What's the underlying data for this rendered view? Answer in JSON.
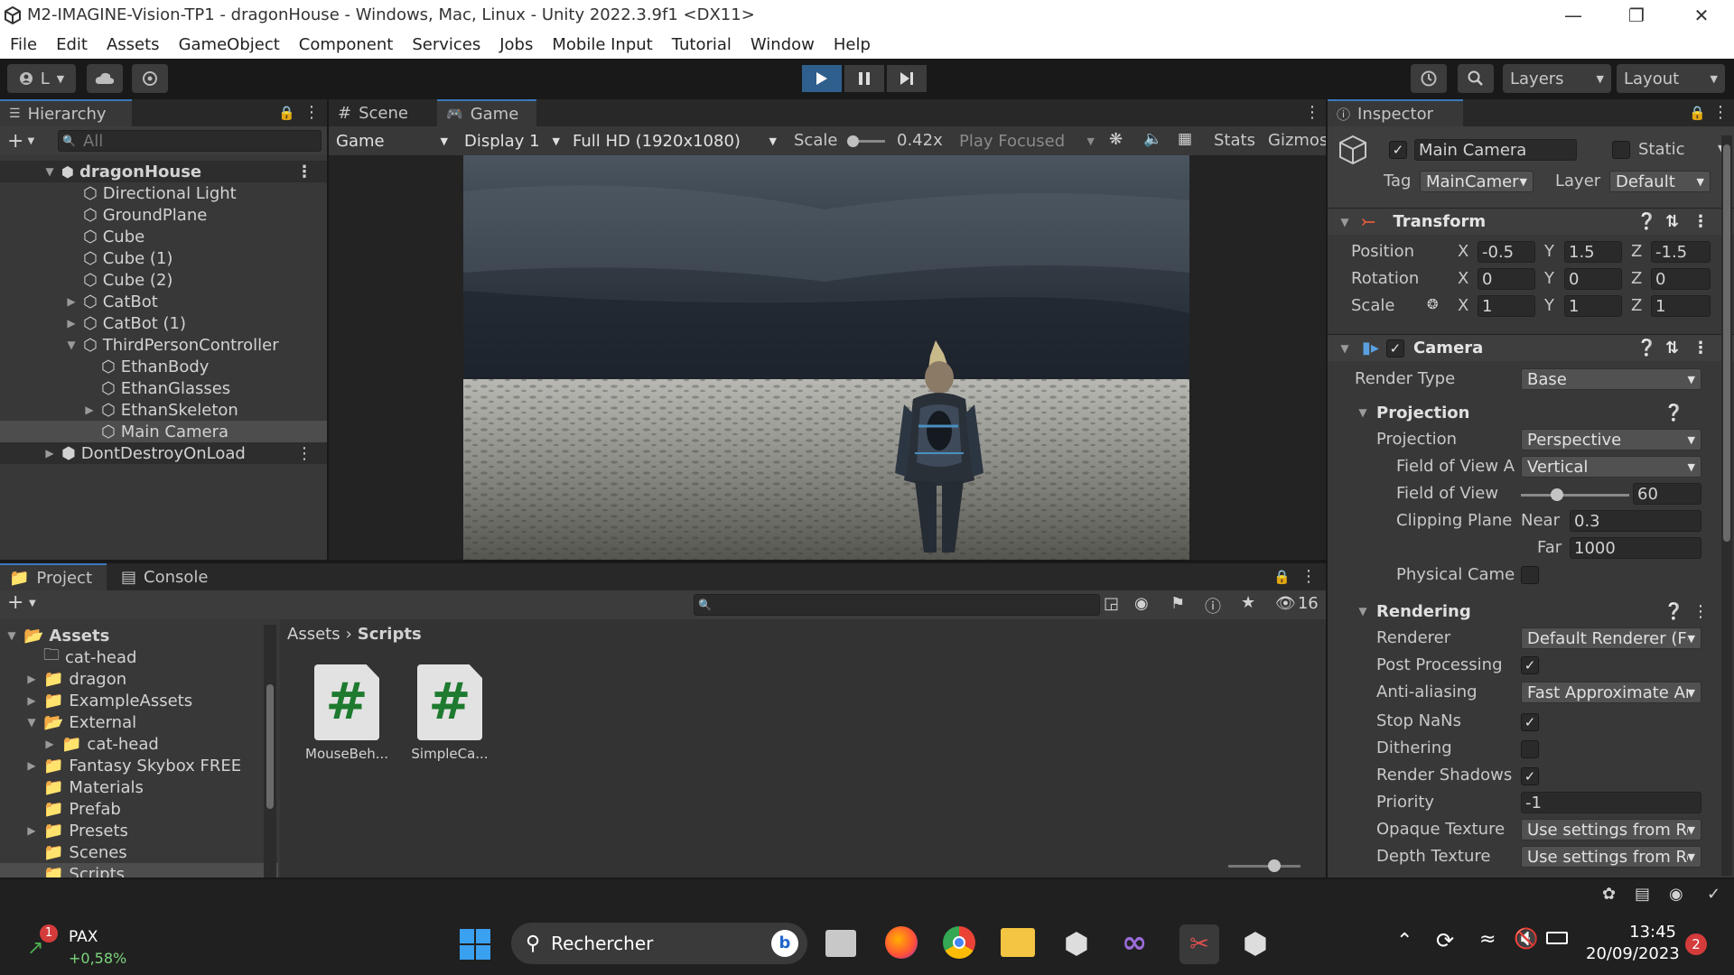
{
  "window": {
    "title": "M2-IMAGINE-Vision-TP1 - dragonHouse - Windows, Mac, Linux - Unity 2022.3.9f1 <DX11>"
  },
  "menu": [
    "File",
    "Edit",
    "Assets",
    "GameObject",
    "Component",
    "Services",
    "Jobs",
    "Mobile Input",
    "Tutorial",
    "Window",
    "Help"
  ],
  "toolbar": {
    "account_label": "L",
    "layers_label": "Layers",
    "layout_label": "Layout"
  },
  "hierarchy": {
    "tab": "Hierarchy",
    "search_placeholder": "All",
    "items": [
      {
        "label": "dragonHouse"
      },
      {
        "label": "Directional Light"
      },
      {
        "label": "GroundPlane"
      },
      {
        "label": "Cube"
      },
      {
        "label": "Cube (1)"
      },
      {
        "label": "Cube (2)"
      },
      {
        "label": "CatBot"
      },
      {
        "label": "CatBot (1)"
      },
      {
        "label": "ThirdPersonController"
      },
      {
        "label": "EthanBody"
      },
      {
        "label": "EthanGlasses"
      },
      {
        "label": "EthanSkeleton"
      },
      {
        "label": "Main Camera"
      },
      {
        "label": "DontDestroyOnLoad"
      }
    ]
  },
  "gameview": {
    "tabs": [
      "Scene",
      "Game"
    ],
    "mode": "Game",
    "display": "Display 1",
    "resolution": "Full HD (1920x1080)",
    "scale_label": "Scale",
    "scale_value": "0.42x",
    "play_focused": "Play Focused",
    "stats": "Stats",
    "gizmos": "Gizmos"
  },
  "inspector": {
    "tab": "Inspector",
    "object_name": "Main Camera",
    "static_label": "Static",
    "tag_label": "Tag",
    "tag_value": "MainCamer",
    "layer_label": "Layer",
    "layer_value": "Default",
    "transform": {
      "title": "Transform",
      "position_label": "Position",
      "rotation_label": "Rotation",
      "scale_label": "Scale",
      "pos": [
        "-0.5",
        "1.5",
        "-1.5"
      ],
      "rot": [
        "0",
        "0",
        "0"
      ],
      "scl": [
        "1",
        "1",
        "1"
      ],
      "axes": [
        "X",
        "Y",
        "Z"
      ]
    },
    "camera": {
      "title": "Camera",
      "render_type_label": "Render Type",
      "render_type": "Base",
      "projection_header": "Projection",
      "projection_label": "Projection",
      "projection_value": "Perspective",
      "fov_axis_label": "Field of View A",
      "fov_axis_value": "Vertical",
      "fov_label": "Field of View",
      "fov_value": "60",
      "fov_fraction": 0.33,
      "clip_label": "Clipping Plane",
      "near_label": "Near",
      "near_value": "0.3",
      "far_label": "Far",
      "far_value": "1000",
      "physical_label": "Physical Came",
      "rendering_header": "Rendering",
      "renderer_label": "Renderer",
      "renderer_value": "Default Renderer (Fc",
      "post_label": "Post Processing",
      "aa_label": "Anti-aliasing",
      "aa_value": "Fast Approximate An",
      "nans_label": "Stop NaNs",
      "dither_label": "Dithering",
      "shadows_label": "Render Shadows",
      "priority_label": "Priority",
      "priority_value": "-1",
      "opaque_label": "Opaque Texture",
      "opaque_value": "Use settings from Re",
      "depth_label": "Depth Texture",
      "depth_value": "Use settings from Re"
    }
  },
  "project": {
    "tabs": [
      "Project",
      "Console"
    ],
    "hidden_count": "16",
    "breadcrumb": [
      "Assets",
      "Scripts"
    ],
    "tree": [
      {
        "label": "Assets"
      },
      {
        "label": "cat-head"
      },
      {
        "label": "dragon"
      },
      {
        "label": "ExampleAssets"
      },
      {
        "label": "External"
      },
      {
        "label": "cat-head"
      },
      {
        "label": "Fantasy Skybox FREE"
      },
      {
        "label": "Materials"
      },
      {
        "label": "Prefab"
      },
      {
        "label": "Presets"
      },
      {
        "label": "Scenes"
      },
      {
        "label": "Scripts"
      }
    ],
    "files": [
      {
        "label": "MouseBeh..."
      },
      {
        "label": "SimpleCa..."
      }
    ]
  },
  "taskbar": {
    "stock_name": "PAX",
    "stock_change": "+0,58%",
    "stock_badge": "1",
    "search": "Rechercher",
    "time": "13:45",
    "date": "20/09/2023",
    "notif": "2"
  },
  "colors": {
    "accent": "#3a79bb",
    "panel": "#383838",
    "bg": "#191919",
    "selected": "#2c5d87",
    "script": "#1e7a2e"
  }
}
